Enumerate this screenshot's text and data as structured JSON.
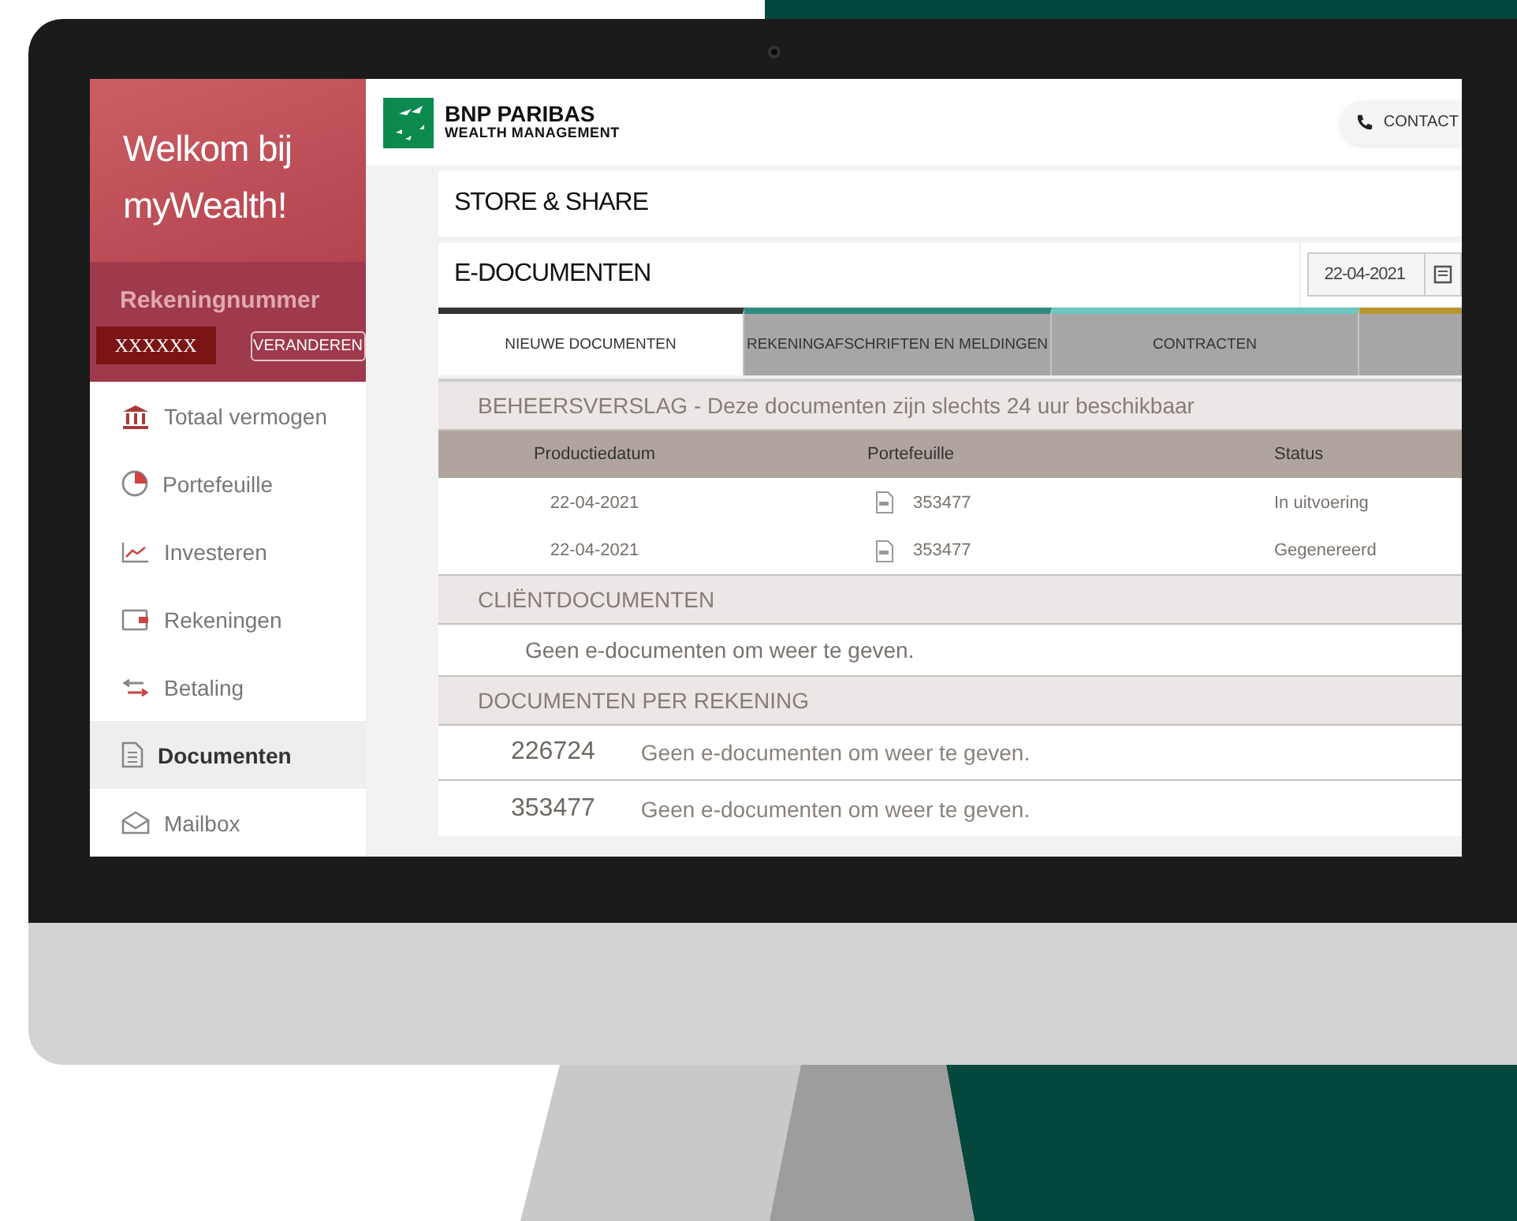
{
  "sidebar": {
    "welcome": "Welkom bij myWealth!",
    "account_label": "Rekeningnummer",
    "account_number": "XXXXXX",
    "change_button": "VERANDEREN",
    "items": [
      {
        "label": "Totaal vermogen",
        "selected": false
      },
      {
        "label": "Portefeuille",
        "selected": false
      },
      {
        "label": "Investeren",
        "selected": false
      },
      {
        "label": "Rekeningen",
        "selected": false
      },
      {
        "label": "Betaling",
        "selected": false
      },
      {
        "label": "Documenten",
        "selected": true
      },
      {
        "label": "Mailbox",
        "selected": false
      }
    ]
  },
  "header": {
    "brand": "BNP PARIBAS",
    "brand_sub": "WEALTH MANAGEMENT",
    "contact_button": "CONTACT"
  },
  "breadcrumb": "STORE & SHARE",
  "page_title": "E-DOCUMENTEN",
  "date_field": {
    "value": "22-04-2021"
  },
  "tabs": [
    {
      "label": "NIEUWE DOCUMENTEN",
      "selected": true,
      "color": "#333333"
    },
    {
      "label": "REKENINGAFSCHRIFTEN EN MELDINGEN",
      "selected": false,
      "color": "#2e8b80"
    },
    {
      "label": "CONTRACTEN",
      "selected": false,
      "color": "#6cc5bf"
    },
    {
      "selected": false,
      "color": "#b8962e"
    }
  ],
  "report_section": {
    "title": "BEHEERSVERSLAG - Deze documenten zijn slechts 24 uur beschikbaar",
    "columns": [
      "Productiedatum",
      "Portefeuille",
      "Status"
    ],
    "rows": [
      {
        "date": "22-04-2021",
        "portfolio": "353477",
        "status": "In uitvoering"
      },
      {
        "date": "22-04-2021",
        "portfolio": "353477",
        "status": "Gegenereerd"
      }
    ]
  },
  "client_section": {
    "title": "CLIËNTDOCUMENTEN",
    "empty_text": "Geen e-documenten om weer te geven."
  },
  "account_section": {
    "title": "DOCUMENTEN PER REKENING",
    "rows": [
      {
        "account": "226724",
        "text": "Geen e-documenten om weer te geven."
      },
      {
        "account": "353477",
        "text": "Geen e-documenten om weer te geven."
      }
    ]
  }
}
